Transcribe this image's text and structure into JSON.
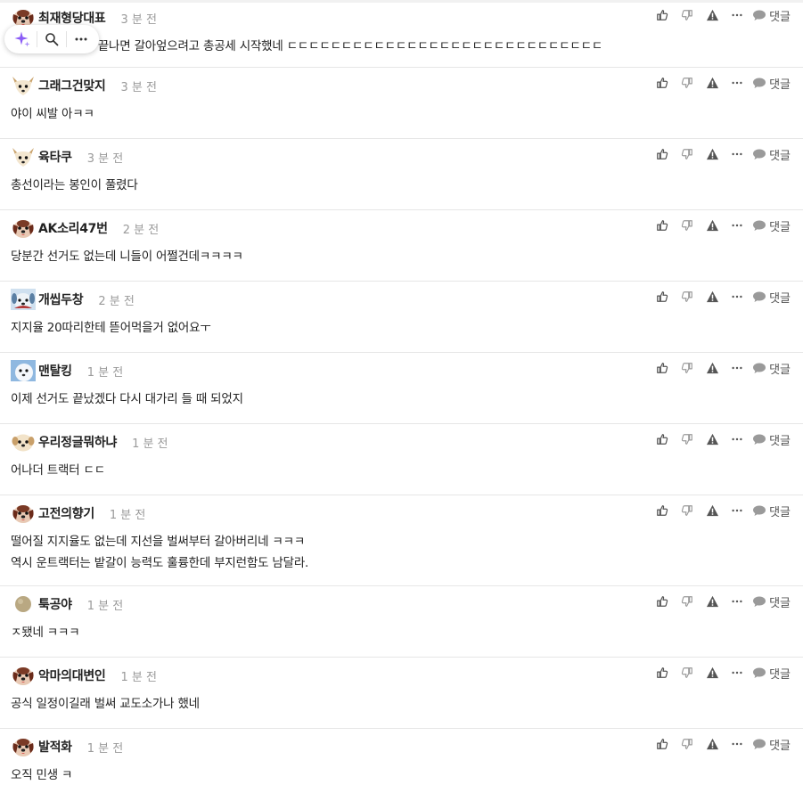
{
  "toolbar": {
    "icons": [
      "sparkle-icon",
      "search-icon",
      "more-icon"
    ]
  },
  "actions": {
    "reply_label": "댓글",
    "icons": [
      "thumbs-up-icon",
      "thumbs-down-icon",
      "report-icon",
      "more-icon",
      "speech-bubble-icon"
    ]
  },
  "colors": {
    "nick": "#222222",
    "time": "#9a9a9a",
    "icon": "#555555",
    "divider": "#e6e6e6",
    "sparkle": "#8b5cf6"
  },
  "comments": [
    {
      "nick": "최재형당대표",
      "time": "3 분 전",
      "avatar": "puppy-dark",
      "lines": [
        "나란 사람은 선거 끝나면 갈아엎으려고 총공세 시작했네 ㄷㄷㄷㄷㄷㄷㄷㄷㄷㄷㄷㄷㄷㄷㄷㄷㄷㄷㄷㄷㄷㄷㄷㄷㄷㄷㄷㄷㄷ"
      ]
    },
    {
      "nick": "그래그건맞지",
      "time": "3 분 전",
      "avatar": "fox",
      "lines": [
        "야이 씨발 아ㅋㅋ"
      ]
    },
    {
      "nick": "육타쿠",
      "time": "3 분 전",
      "avatar": "fox",
      "lines": [
        "총선이라는 봉인이 풀렸다"
      ]
    },
    {
      "nick": "AK소리47번",
      "time": "2 분 전",
      "avatar": "puppy-dark",
      "lines": [
        "당분간 선거도 없는데 니들이 어쩔건데ㅋㅋㅋㅋ"
      ]
    },
    {
      "nick": "개씹두창",
      "time": "2 분 전",
      "avatar": "blue-dog",
      "lines": [
        "지지율 20따리한테 뜯어먹을거 없어요ㅜ"
      ]
    },
    {
      "nick": "맨탈킹",
      "time": "1 분 전",
      "avatar": "blue-ghost",
      "lines": [
        "이제 선거도 끝났겠다 다시 대가리 들 때 되었지"
      ]
    },
    {
      "nick": "우리정글뭐하냐",
      "time": "1 분 전",
      "avatar": "puppy-light",
      "lines": [
        "어나더 트랙터 ㄷㄷ"
      ]
    },
    {
      "nick": "고전의향기",
      "time": "1 분 전",
      "avatar": "puppy-dark",
      "lines": [
        "떨어질 지지율도 없는데 지선을 벌써부터 갈아버리네 ㅋㅋㅋ",
        "역시 운트랙터는 밭갈이 능력도 훌륭한데 부지런함도 남달라."
      ]
    },
    {
      "nick": "툭공야",
      "time": "1 분 전",
      "avatar": "ball",
      "lines": [
        "ㅈ됐네 ㅋㅋㅋ"
      ]
    },
    {
      "nick": "악마의대변인",
      "time": "1 분 전",
      "avatar": "puppy-dark",
      "lines": [
        "공식 일정이길래 벌써 교도소가나 했네"
      ]
    },
    {
      "nick": "발적화",
      "time": "1 분 전",
      "avatar": "puppy-dark",
      "lines": [
        "오직 민생 ㅋ"
      ]
    }
  ]
}
